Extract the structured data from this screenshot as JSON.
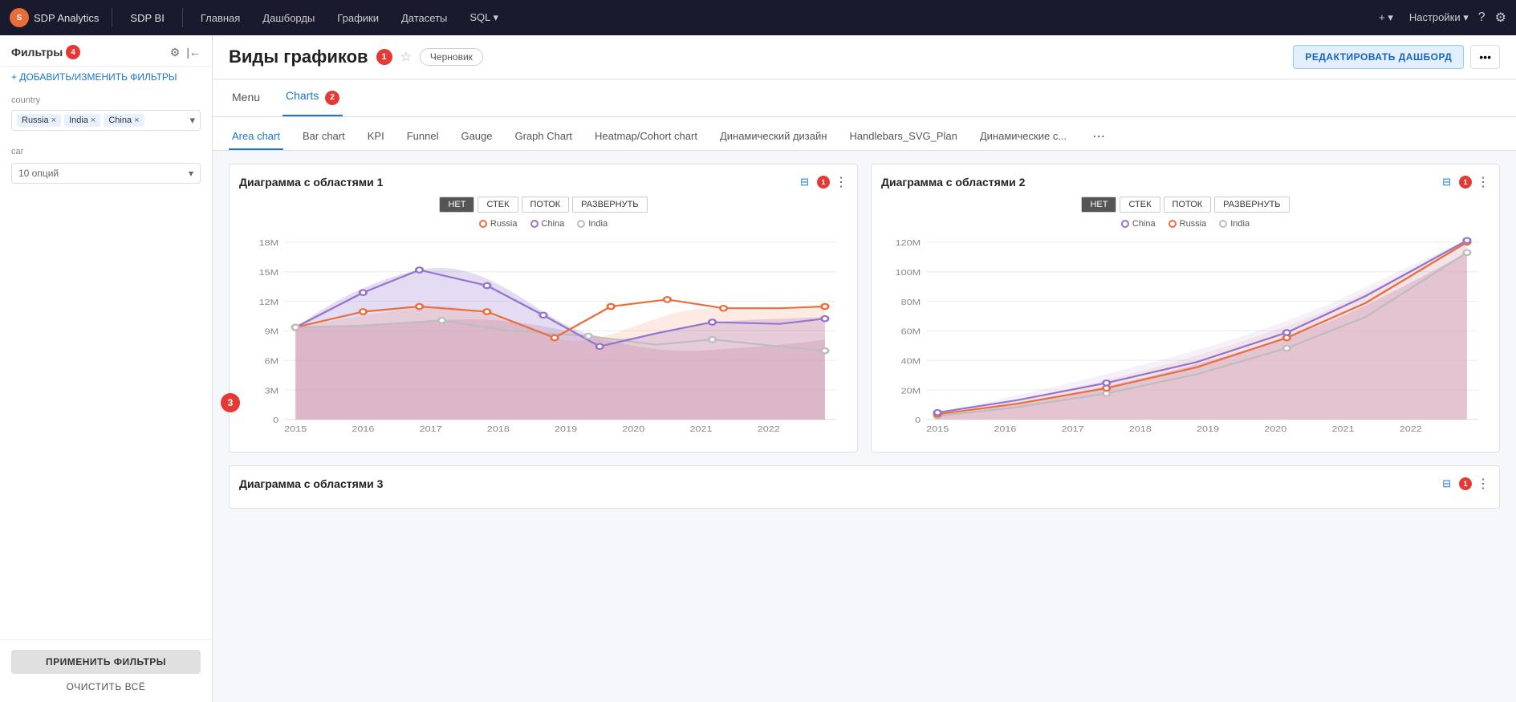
{
  "app": {
    "brand": "SDP Analytics",
    "brand2": "SDP BI",
    "nav_items": [
      "Главная",
      "Дашборды",
      "Графики",
      "Датасеты",
      "SQL"
    ],
    "sql_arrow": "▾",
    "right_plus": "+ ▾",
    "right_settings": "Настройки ▾",
    "right_help": "?",
    "right_gear": "⚙"
  },
  "sidebar": {
    "title": "Фильтры",
    "badge": "4",
    "add_filter": "+ ДОБАВИТЬ/ИЗМЕНИТЬ ФИЛЬТРЫ",
    "filters": [
      {
        "label": "country",
        "tags": [
          "Russia",
          "India",
          "China"
        ]
      },
      {
        "label": "car",
        "placeholder": "10 опций"
      }
    ],
    "apply_label": "ПРИМЕНИТЬ ФИЛЬТРЫ",
    "clear_label": "ОЧИСТИТЬ ВСЁ"
  },
  "header": {
    "title": "Виды графиков",
    "badge": "1",
    "draft": "Черновик",
    "edit_btn": "РЕДАКТИРОВАТЬ ДАШБОРД",
    "more": "•••"
  },
  "tabs": [
    {
      "label": "Menu",
      "active": false
    },
    {
      "label": "Charts",
      "active": true,
      "badge": "2"
    }
  ],
  "sub_tabs": [
    {
      "label": "Area chart",
      "active": true
    },
    {
      "label": "Bar chart",
      "active": false
    },
    {
      "label": "KPI",
      "active": false
    },
    {
      "label": "Funnel",
      "active": false
    },
    {
      "label": "Gauge",
      "active": false
    },
    {
      "label": "Graph Chart",
      "active": false
    },
    {
      "label": "Heatmap/Cohort chart",
      "active": false
    },
    {
      "label": "Динамический дизайн",
      "active": false
    },
    {
      "label": "Handlebars_SVG_Plan",
      "active": false
    },
    {
      "label": "Динамические с...",
      "active": false
    }
  ],
  "chart1": {
    "title": "Диаграмма с областями 1",
    "filter_badge": "1",
    "controls": [
      "НЕТ",
      "СТЕК",
      "ПОТОК",
      "РАЗВЕРНУТЬ"
    ],
    "active_control": "НЕТ",
    "legend": [
      {
        "label": "Russia",
        "color": "#e87040",
        "fill": "none"
      },
      {
        "label": "China",
        "color": "#9575cd",
        "fill": "none"
      },
      {
        "label": "India",
        "color": "#bdbdbd",
        "fill": "none"
      }
    ],
    "y_labels": [
      "18M",
      "15M",
      "12M",
      "9M",
      "6M",
      "3M",
      "0"
    ],
    "x_labels": [
      "2015",
      "2016",
      "2017",
      "2018",
      "2019",
      "2020",
      "2021",
      "2022",
      ""
    ]
  },
  "chart2": {
    "title": "Диаграмма с областями 2",
    "filter_badge": "1",
    "controls": [
      "НЕТ",
      "СТЕК",
      "ПОТОК",
      "РАЗВЕРНУТЬ"
    ],
    "active_control": "НЕТ",
    "legend": [
      {
        "label": "China",
        "color": "#9575cd",
        "fill": "none"
      },
      {
        "label": "Russia",
        "color": "#e87040",
        "fill": "none"
      },
      {
        "label": "India",
        "color": "#bdbdbd",
        "fill": "none"
      }
    ],
    "y_labels": [
      "120M",
      "100M",
      "80M",
      "60M",
      "40M",
      "20M",
      "0"
    ],
    "x_labels": [
      "2015",
      "2016",
      "2017",
      "2018",
      "2019",
      "2020",
      "2021",
      "2022",
      ""
    ]
  },
  "chart3": {
    "title": "Диаграмма с областями 3",
    "filter_badge": "1"
  },
  "circle3": "3",
  "colors": {
    "accent": "#1976d2",
    "danger": "#e53935",
    "orange": "#e87040",
    "purple": "#9575cd",
    "gray": "#bdbdbd"
  }
}
